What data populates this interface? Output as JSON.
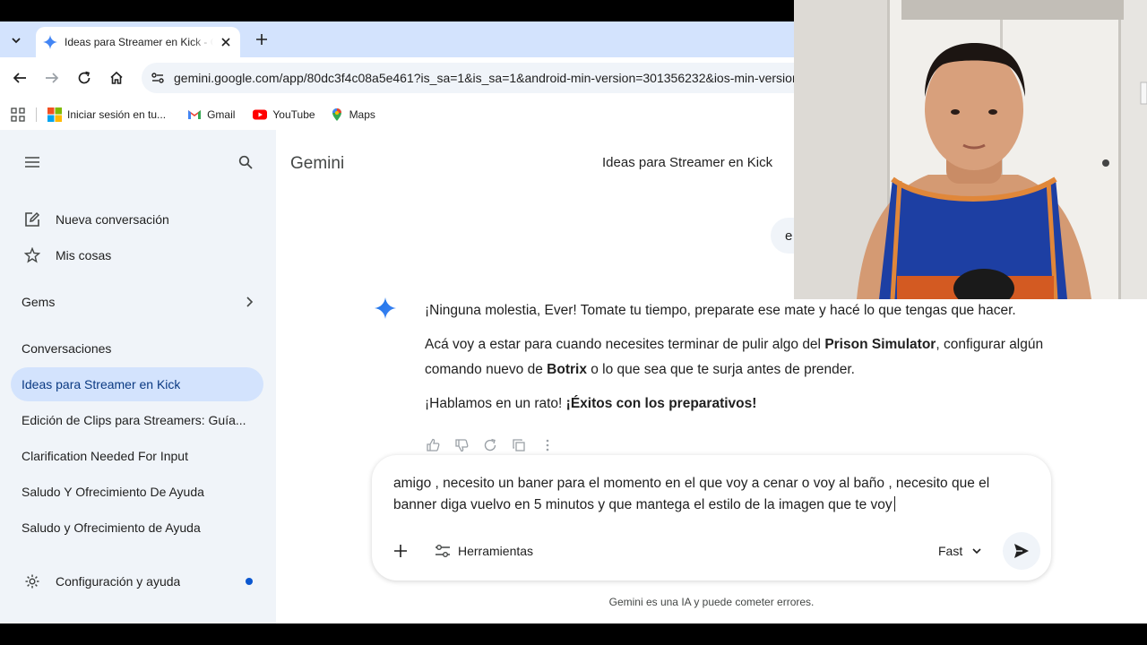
{
  "browser": {
    "tab_title": "Ideas para Streamer en Kick - Gemini",
    "url": "gemini.google.com/app/80dc3f4c08a5e461?is_sa=1&is_sa=1&android-min-version=301356232&ios-min-version",
    "bookmarks": [
      {
        "label": "Iniciar sesión en tu...",
        "icon": "microsoft-icon"
      },
      {
        "label": "Gmail",
        "icon": "gmail-icon"
      },
      {
        "label": "YouTube",
        "icon": "youtube-icon"
      },
      {
        "label": "Maps",
        "icon": "maps-icon"
      }
    ]
  },
  "sidebar": {
    "new_chat": "Nueva conversación",
    "my_stuff": "Mis cosas",
    "gems": "Gems",
    "conversations_heading": "Conversaciones",
    "conversations": [
      "Ideas para Streamer en Kick",
      "Edición de Clips para Streamers: Guía...",
      "Clarification Needed For Input",
      "Saludo Y Ofrecimiento De Ayuda",
      "Saludo y Ofrecimiento de Ayuda"
    ],
    "settings": "Configuración y ayuda"
  },
  "main": {
    "brand": "Gemini",
    "chat_title": "Ideas para Streamer en Kick",
    "user_bubble_text": "e",
    "reply": {
      "p1": "¡Ninguna molestia, Ever! Tomate tu tiempo, preparate ese mate y hacé lo que tengas que hacer.",
      "p2_a": "Acá voy a estar para cuando necesites terminar de pulir algo del ",
      "p2_b": "Prison Simulator",
      "p2_c": ", configurar algún comando nuevo de ",
      "p2_d": "Botrix",
      "p2_e": " o lo que sea que te surja antes de prender.",
      "p3_a": "¡Hablamos en un rato! ",
      "p3_b": "¡Éxitos con los preparativos!"
    },
    "composer_text": "amigo , necesito un baner para el momento en el que voy a cenar o voy al baño , necesito que el banner diga vuelvo en 5 minutos y que mantega el estilo de la imagen que te voy",
    "tools_label": "Herramientas",
    "model_label": "Fast",
    "disclaimer": "Gemini es una IA y puede cometer errores."
  },
  "colors": {
    "accent": "#0b57d0",
    "sidebar_bg": "#f0f4f9",
    "active_conv": "#d3e3fd",
    "tabstrip": "#d3e3fd"
  }
}
